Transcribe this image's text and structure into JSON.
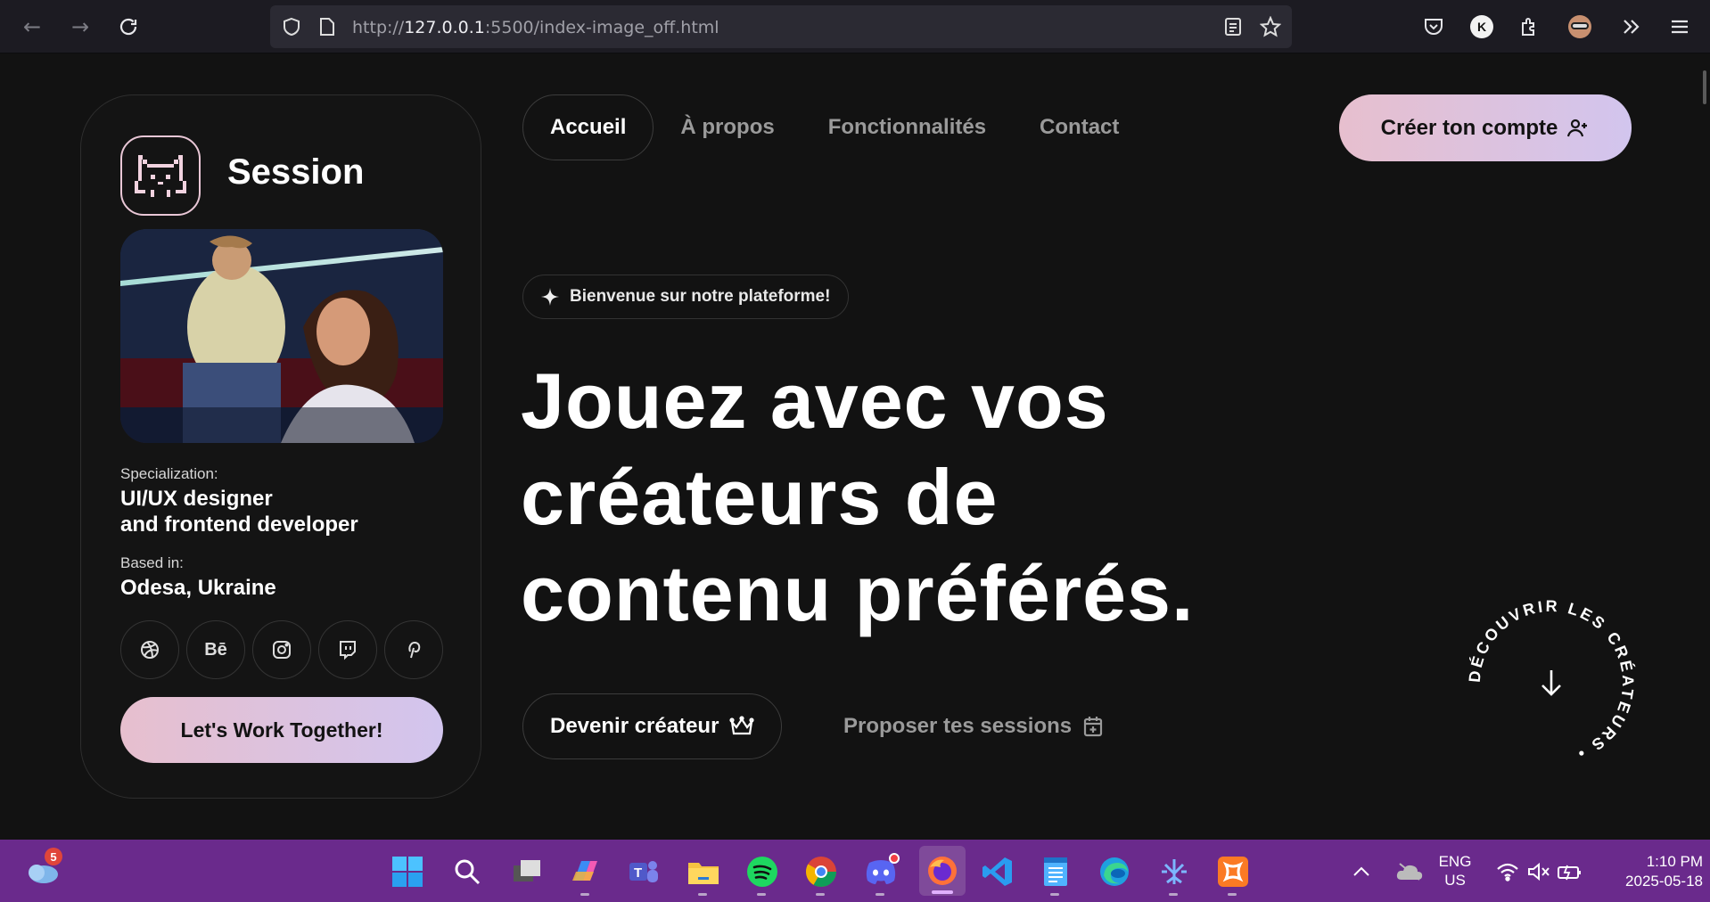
{
  "browser": {
    "url_prefix": "http://",
    "url_host": "127.0.0.1",
    "url_rest": ":5500/index-image_off.html",
    "profile_initial": "K"
  },
  "sidebar_card": {
    "brand": "Session",
    "spec_label": "Specialization:",
    "spec_line1": "UI/UX designer",
    "spec_line2": "and frontend developer",
    "based_label": "Based in:",
    "based_value": "Odesa, Ukraine",
    "socials": [
      "dribbble-icon",
      "Bē",
      "instagram-icon",
      "twitch-icon",
      "pinterest-icon"
    ],
    "behance_text": "Bē",
    "cta": "Let's Work Together!"
  },
  "nav": {
    "items": [
      "Accueil",
      "À propos",
      "Fonctionnalités",
      "Contact"
    ],
    "signup": "Créer ton compte"
  },
  "hero": {
    "badge": "Bienvenue sur notre plateforme!",
    "line1": "Jouez avec vos",
    "line2": "créateurs de",
    "line3": "contenu préférés.",
    "btn_creator": "Devenir créateur",
    "btn_sessions": "Proposer tes sessions",
    "circle_text": "DÉCOUVRIR LES CRÉATEURS • "
  },
  "taskbar": {
    "weather_badge": "5",
    "lang_line1": "ENG",
    "lang_line2": "US",
    "time": "1:10 PM",
    "date": "2025-05-18"
  },
  "colors": {
    "accent_gradient_start": "#e7bfce",
    "accent_gradient_end": "#d2c5ee",
    "page_bg": "#121212",
    "taskbar": "#6a2a8c"
  }
}
